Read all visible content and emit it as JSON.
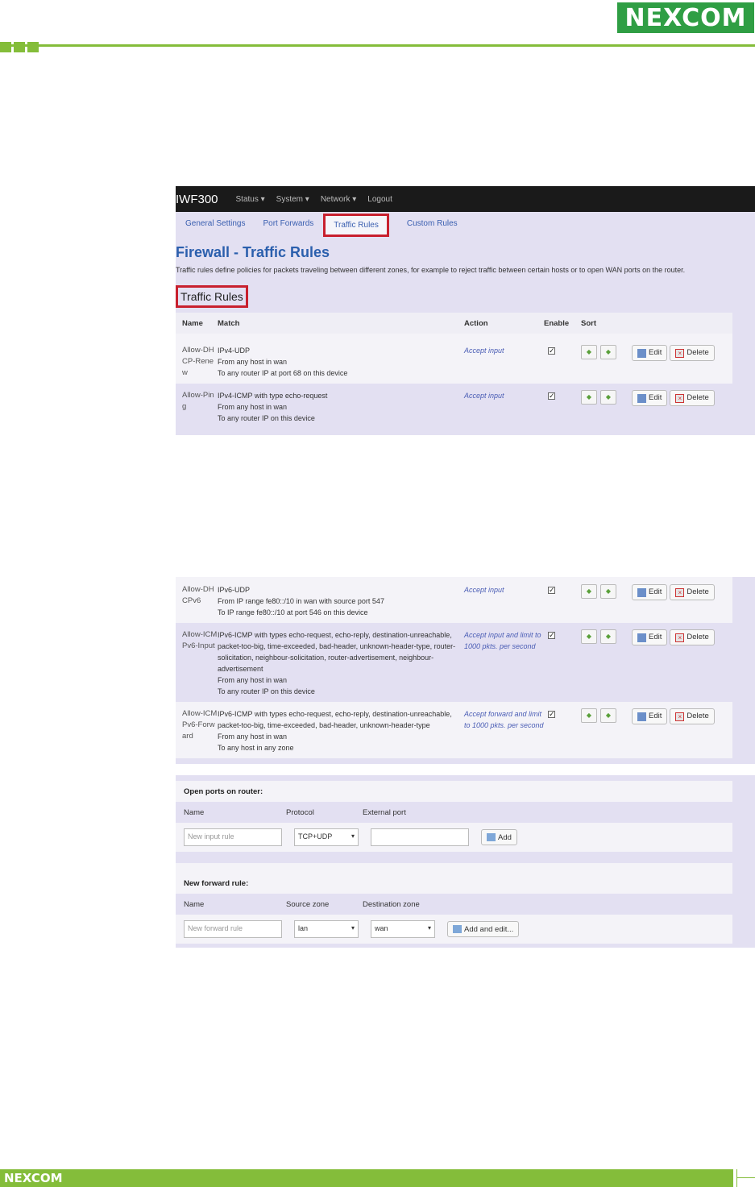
{
  "brand_logo_text": "NEXCOM",
  "app": {
    "title": "IWF300",
    "menu": [
      "Status ▾",
      "System ▾",
      "Network ▾",
      "Logout"
    ]
  },
  "tabs": [
    {
      "label": "General Settings"
    },
    {
      "label": "Port Forwards"
    },
    {
      "label": "Traffic Rules",
      "active": true
    },
    {
      "label": "Custom Rules"
    }
  ],
  "page": {
    "title": "Firewall - Traffic Rules",
    "description": "Traffic rules define policies for packets traveling between different zones, for example to reject traffic between certain hosts or to open WAN ports on the router.",
    "section": "Traffic Rules"
  },
  "table": {
    "headers": [
      "Name",
      "Match",
      "Action",
      "Enable",
      "Sort"
    ],
    "edit_label": "Edit",
    "delete_label": "Delete",
    "rows_panel1": [
      {
        "name": "Allow-DHCP-Renew",
        "match": [
          "IPv4-UDP",
          "From any host in wan",
          "To any router IP at port 68 on this device"
        ],
        "action": "Accept input"
      },
      {
        "name": "Allow-Ping",
        "match": [
          "IPv4-ICMP with type echo-request",
          "From any host in wan",
          "To any router IP on this device"
        ],
        "action": "Accept input"
      }
    ],
    "rows_panel2": [
      {
        "name": "Allow-DHCPv6",
        "match": [
          "IPv6-UDP",
          "From IP range fe80::/10 in wan with source port 547",
          "To IP range fe80::/10 at port 546 on this device"
        ],
        "action": "Accept input"
      },
      {
        "name": "Allow-ICMPv6-Input",
        "match": [
          "IPv6-ICMP with types echo-request, echo-reply, destination-unreachable,",
          "packet-too-big, time-exceeded, bad-header, unknown-header-type, router-",
          "solicitation, neighbour-solicitation, router-advertisement, neighbour-",
          "advertisement",
          "From any host in wan",
          "To any router IP on this device"
        ],
        "action": "Accept input and limit to 1000 pkts. per second"
      },
      {
        "name": "Allow-ICMPv6-Forward",
        "match": [
          "IPv6-ICMP with types echo-request, echo-reply, destination-unreachable,",
          "packet-too-big, time-exceeded, bad-header, unknown-header-type",
          "From any host in wan",
          "To any host in any zone"
        ],
        "action": "Accept forward and limit to 1000 pkts. per second"
      }
    ]
  },
  "open_ports": {
    "heading": "Open ports on router:",
    "cols": [
      "Name",
      "Protocol",
      "External port"
    ],
    "name_placeholder": "New input rule",
    "protocol": "TCP+UDP",
    "add_label": "Add"
  },
  "new_forward": {
    "heading": "New forward rule:",
    "cols": [
      "Name",
      "Source zone",
      "Destination zone"
    ],
    "name_placeholder": "New forward rule",
    "source": "lan",
    "destination": "wan",
    "add_label": "Add and edit..."
  },
  "colors": {
    "brand_green": "#84bd3a",
    "highlight_red": "#c8202e",
    "link_blue": "#4a5db5"
  }
}
